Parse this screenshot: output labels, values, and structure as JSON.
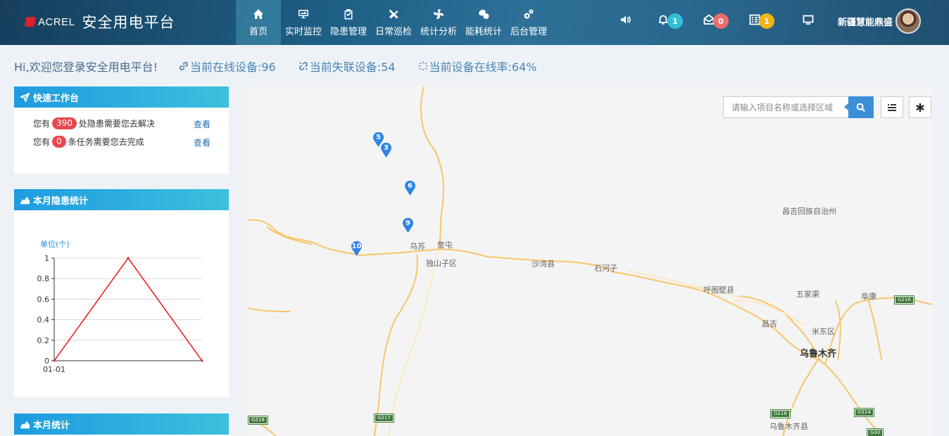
{
  "header": {
    "brand": "ACREL",
    "title": "安全用电平台",
    "nav": [
      {
        "label": "首页",
        "icon": "home-icon"
      },
      {
        "label": "实时监控",
        "icon": "monitor-icon"
      },
      {
        "label": "隐患管理",
        "icon": "clipboard-icon"
      },
      {
        "label": "日常巡检",
        "icon": "tools-icon"
      },
      {
        "label": "统计分析",
        "icon": "fan-icon"
      },
      {
        "label": "能耗统计",
        "icon": "pills-icon"
      },
      {
        "label": "后台管理",
        "icon": "gears-icon"
      }
    ],
    "alerts": {
      "bell_count": "1",
      "mail_count": "0",
      "task_count": "1",
      "bell_color": "#32c0d8",
      "mail_color": "#ef6c6c",
      "task_color": "#f2b514"
    },
    "user_name": "新疆慧能鼎盛"
  },
  "stats": {
    "welcome": "Hi,欢迎您登录安全用电平台!",
    "online": "当前在线设备:96",
    "offline": "当前失联设备:54",
    "rate": "当前设备在线率:64%"
  },
  "quick": {
    "title": "快速工作台",
    "row1_prefix": "您有",
    "row1_count": "390",
    "row1_suffix": "处隐患需要您去解决",
    "row2_prefix": "您有",
    "row2_count": "0",
    "row2_suffix": "条任务需要您去完成",
    "view_label": "查看"
  },
  "hazard_panel": {
    "title": "本月隐患统计"
  },
  "monthly_panel": {
    "title": "本月统计"
  },
  "chart_data": {
    "type": "line",
    "unit_label": "单位(个)",
    "x": [
      "01-01",
      "",
      ""
    ],
    "x_tick_labels": [
      "01-01"
    ],
    "series": [
      {
        "values": [
          0,
          1,
          0
        ],
        "color": "#e82424"
      }
    ],
    "ylim": [
      0,
      1
    ],
    "yticks": [
      "0",
      "0.2",
      "0.4",
      "0.6",
      "0.8",
      "1"
    ],
    "grid": true
  },
  "map": {
    "search_placeholder": "请输入项目名称或选择区域",
    "places": [
      {
        "name": "乌苏"
      },
      {
        "name": "奎屯"
      },
      {
        "name": "独山子区"
      },
      {
        "name": "沙湾县"
      },
      {
        "name": "石河子"
      },
      {
        "name": "昌吉回族自治州"
      },
      {
        "name": "呼图壁县"
      },
      {
        "name": "五家渠"
      },
      {
        "name": "阜康"
      },
      {
        "name": "昌吉"
      },
      {
        "name": "米东区"
      },
      {
        "name": "乌鲁木齐"
      },
      {
        "name": "乌鲁木齐县"
      }
    ],
    "shields": [
      "G218",
      "G217",
      "G216",
      "G314",
      "G216",
      "G30"
    ],
    "markers": [
      "5",
      "3",
      "6",
      "9",
      "10"
    ],
    "marker_color": "#2f83e4"
  }
}
